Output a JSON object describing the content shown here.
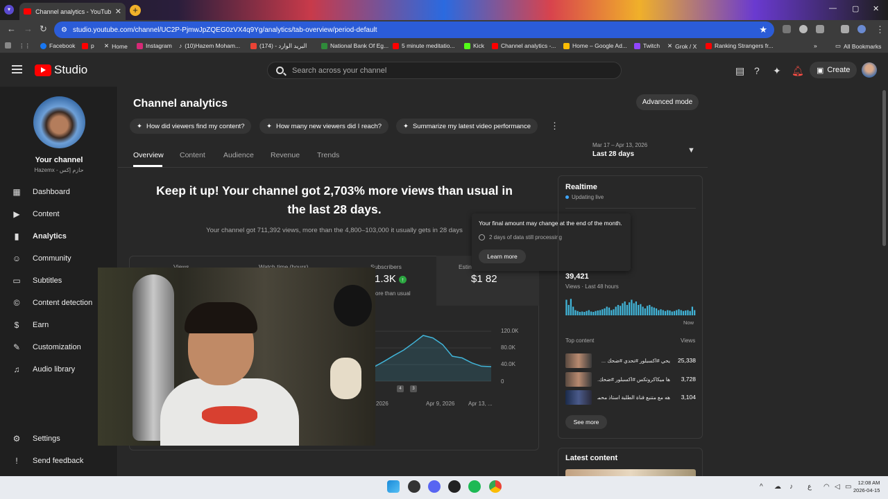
{
  "browser": {
    "tab_title": "Channel analytics - YouTube St",
    "url": "studio.youtube.com/channel/UC2P-PjmwJpZQEG0zVX4q9Yg/analytics/tab-overview/period-default",
    "bookmarks": [
      "Facebook",
      "p",
      "Home",
      "Instagram",
      "(10)Hazem Moham...",
      "(174) - البريد الوارد",
      "National Bank Of Eg...",
      "5 minute meditatio...",
      "Kick",
      "Channel analytics -...",
      "Home – Google Ad...",
      "Twitch",
      "Grok / X",
      "Ranking Strangers fr..."
    ],
    "all_bookmarks": "All Bookmarks"
  },
  "header": {
    "logo_text": "Studio",
    "search_placeholder": "Search across your channel",
    "create_label": "Create"
  },
  "sidebar": {
    "channel_label": "Your channel",
    "channel_handle": "Hazemx - حازم إكس",
    "items": [
      {
        "label": "Dashboard",
        "icon": "dashboard-icon"
      },
      {
        "label": "Content",
        "icon": "content-icon"
      },
      {
        "label": "Analytics",
        "icon": "analytics-icon"
      },
      {
        "label": "Community",
        "icon": "community-icon"
      },
      {
        "label": "Subtitles",
        "icon": "subtitles-icon"
      },
      {
        "label": "Content detection",
        "icon": "copyright-icon"
      },
      {
        "label": "Earn",
        "icon": "dollar-icon"
      },
      {
        "label": "Customization",
        "icon": "customization-icon"
      },
      {
        "label": "Audio library",
        "icon": "audio-library-icon"
      }
    ],
    "settings": "Settings",
    "feedback": "Send feedback"
  },
  "main": {
    "title": "Channel analytics",
    "advanced_mode": "Advanced mode",
    "chips": [
      "How did viewers find my content?",
      "How many new viewers did I reach?",
      "Summarize my latest video performance"
    ],
    "tabs": [
      "Overview",
      "Content",
      "Audience",
      "Revenue",
      "Trends"
    ],
    "date_small": "Mar 17 – Apr 13, 2026",
    "date_big": "Last 28 days",
    "headline_1": "Keep it up! Your channel got 2,703% more views than usual in",
    "headline_2": "the last 28 days.",
    "subtext": "Your channel got 711,392 views, more than the 4,800–103,000 it usually gets in 28 days",
    "metrics": [
      {
        "label": "Views",
        "value": ""
      },
      {
        "label": "Watch time (hours)",
        "value": ""
      },
      {
        "label": "Subscribers",
        "value": "1.3K",
        "note": "ore than usual"
      },
      {
        "label": "Estin",
        "value": "$1 82"
      }
    ],
    "tooltip": {
      "main": "Your final amount may change at the end of the month.",
      "processing": "2 days of data still processing",
      "learn_more": "Learn more"
    }
  },
  "chart_data": {
    "type": "line",
    "x": [
      "2026",
      "Apr 9, 2026",
      "Apr 13, ..."
    ],
    "yticks": [
      "120.0K",
      "80.0K",
      "40.0K",
      "0"
    ],
    "ylim": [
      0,
      120000
    ],
    "markers": [
      "4",
      "3"
    ],
    "series": [
      {
        "values": [
          35000,
          48000,
          62000,
          75000,
          92000,
          110000,
          104000,
          88000,
          60000,
          56000,
          44000,
          36000,
          35000
        ]
      }
    ]
  },
  "realtime": {
    "title": "Realtime",
    "live": "Updating live",
    "count": "39,421",
    "sub": "Views · Last 48 hours",
    "now": "Now",
    "bars": [
      0.9,
      0.6,
      0.95,
      0.5,
      0.3,
      0.25,
      0.2,
      0.22,
      0.2,
      0.25,
      0.3,
      0.22,
      0.2,
      0.25,
      0.28,
      0.3,
      0.35,
      0.4,
      0.5,
      0.45,
      0.3,
      0.35,
      0.5,
      0.6,
      0.55,
      0.7,
      0.8,
      0.6,
      0.75,
      0.9,
      0.7,
      0.8,
      0.6,
      0.65,
      0.5,
      0.4,
      0.55,
      0.6,
      0.5,
      0.45,
      0.4,
      0.3,
      0.35,
      0.3,
      0.25,
      0.3,
      0.28,
      0.22,
      0.25,
      0.3,
      0.35,
      0.3,
      0.25,
      0.28,
      0.3,
      0.25,
      0.5,
      0.3
    ],
    "top_content_label": "Top content",
    "views_label": "Views",
    "top": [
      {
        "title": "يحي #اكسبلور #تحدي #ضحك ...",
        "views": "25,338"
      },
      {
        "title": "ها ميكاكروتكس #اكسبلور #ضحك...",
        "views": "3,728"
      },
      {
        "title": "هه مع متنبع قناة الطلبة استاذ محمود...",
        "views": "3,104"
      }
    ],
    "see_more": "See more",
    "latest_content": "Latest content"
  },
  "taskbar": {
    "time": "12:08 AM",
    "date": "2026-04-15"
  }
}
